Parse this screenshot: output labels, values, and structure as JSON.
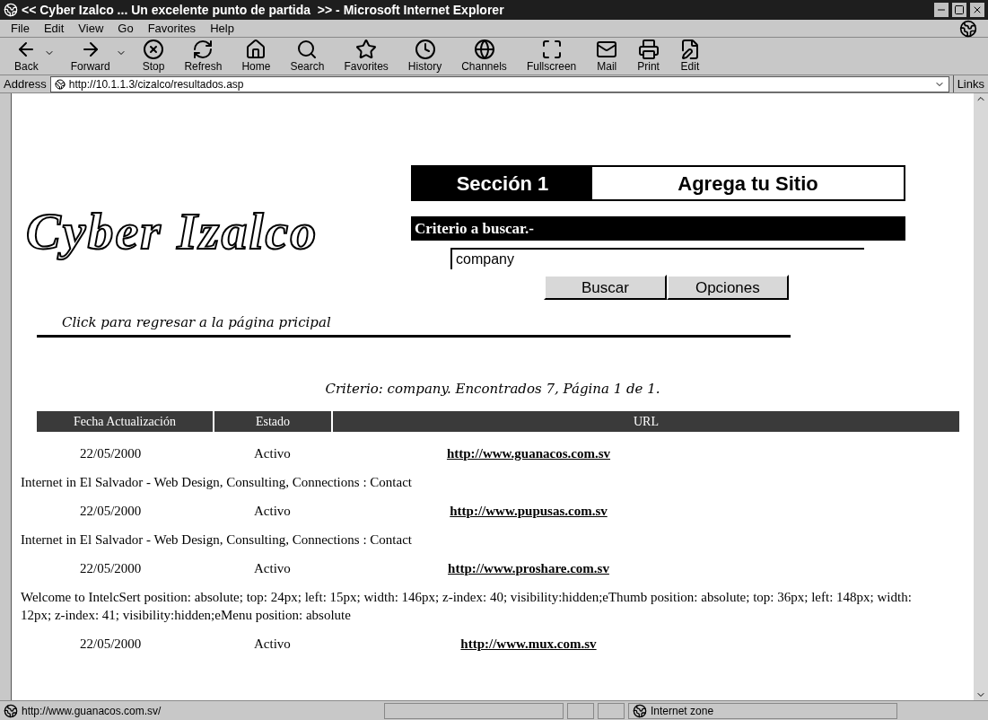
{
  "window": {
    "title": "<< Cyber Izalco ... Un excelente punto de partida  >> - Microsoft Internet Explorer"
  },
  "menu": [
    "File",
    "Edit",
    "View",
    "Go",
    "Favorites",
    "Help"
  ],
  "toolbar": [
    {
      "label": "Back",
      "kind": "back",
      "dropdown": true
    },
    {
      "label": "Forward",
      "kind": "forward",
      "dropdown": true
    },
    {
      "label": "Stop",
      "kind": "stop",
      "dropdown": false
    },
    {
      "label": "Refresh",
      "kind": "refresh",
      "dropdown": false
    },
    {
      "label": "Home",
      "kind": "home",
      "dropdown": false
    },
    {
      "label": "Search",
      "kind": "search",
      "dropdown": false
    },
    {
      "label": "Favorites",
      "kind": "favorites",
      "dropdown": false
    },
    {
      "label": "History",
      "kind": "history",
      "dropdown": false
    },
    {
      "label": "Channels",
      "kind": "channels",
      "dropdown": false
    },
    {
      "label": "Fullscreen",
      "kind": "fullscreen",
      "dropdown": false
    },
    {
      "label": "Mail",
      "kind": "mail",
      "dropdown": false
    },
    {
      "label": "Print",
      "kind": "print",
      "dropdown": false
    },
    {
      "label": "Edit",
      "kind": "edit",
      "dropdown": false
    }
  ],
  "address_bar": {
    "label": "Address",
    "value": "http://10.1.1.3/cizalco/resultados.asp",
    "links": "Links"
  },
  "page": {
    "logo": "Cyber Izalco",
    "sections": [
      {
        "label": "Sección 1",
        "selected": true
      },
      {
        "label": "Agrega tu Sitio",
        "selected": false
      }
    ],
    "back_link": "Click para regresar a la página pricipal",
    "search": {
      "heading": "Criterio a buscar.-",
      "value": "company",
      "buttons": [
        "Buscar",
        "Opciones"
      ]
    },
    "summary": "Criterio: company. Encontrados 7, Página 1 de 1.",
    "table": {
      "columns": [
        "Fecha Actualización",
        "Estado",
        "URL"
      ],
      "rows": [
        {
          "date": "22/05/2000",
          "status": "Activo",
          "url": "http://www.guanacos.com.sv",
          "description": "Internet in El Salvador - Web Design, Consulting, Connections : Contact"
        },
        {
          "date": "22/05/2000",
          "status": "Activo",
          "url": "http://www.pupusas.com.sv",
          "description": "Internet in El Salvador - Web Design, Consulting, Connections : Contact"
        },
        {
          "date": "22/05/2000",
          "status": "Activo",
          "url": "http://www.proshare.com.sv",
          "description": "Welcome to IntelcSert position: absolute; top: 24px; left: 15px; width: 146px; z-index: 40; visibility:hidden;eThumb position: absolute; top: 36px; left: 148px; width: 12px; z-index: 41; visibility:hidden;eMenu position: absolute"
        },
        {
          "date": "22/05/2000",
          "status": "Activo",
          "url": "http://www.mux.com.sv"
        }
      ]
    }
  },
  "status_bar": {
    "text": "http://www.guanacos.com.sv/",
    "zone": "Internet zone"
  }
}
